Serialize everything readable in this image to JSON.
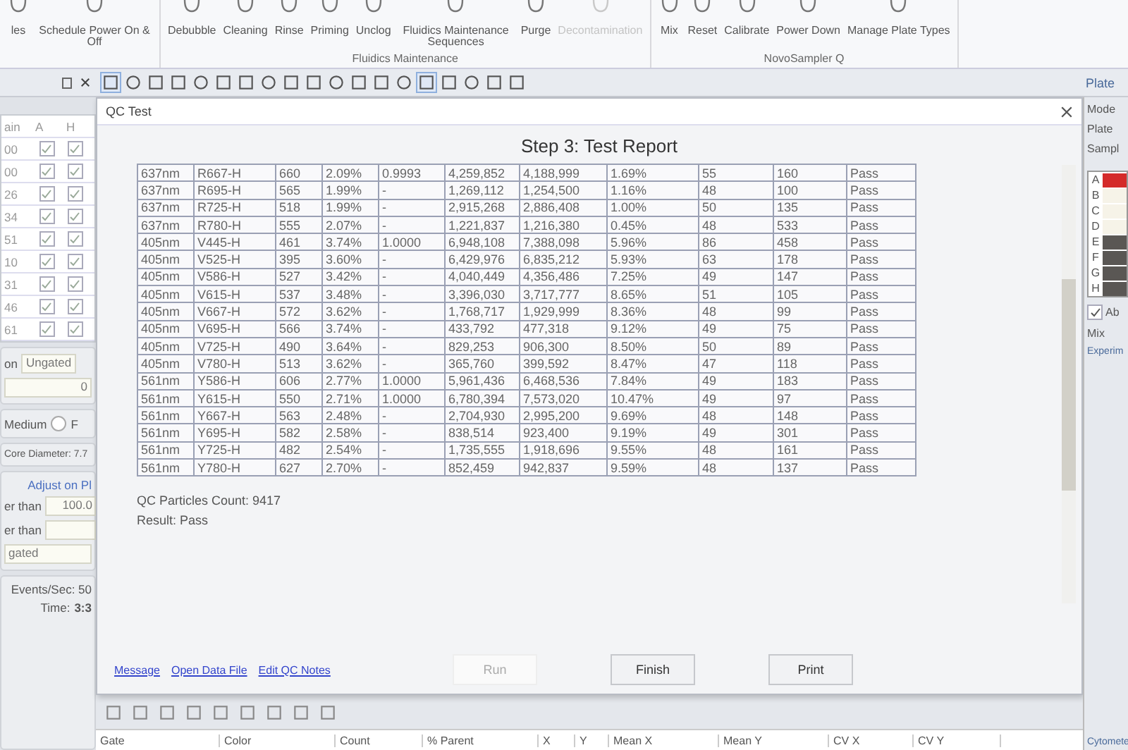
{
  "ribbon": {
    "groups": [
      {
        "items": [
          {
            "label": "les",
            "disabled": false
          },
          {
            "label": "Schedule Power On & Off",
            "disabled": false
          }
        ]
      },
      {
        "label": "Fluidics Maintenance",
        "items": [
          {
            "label": "Debubble",
            "disabled": false
          },
          {
            "label": "Cleaning",
            "disabled": false
          },
          {
            "label": "Rinse",
            "disabled": false
          },
          {
            "label": "Priming",
            "disabled": false
          },
          {
            "label": "Unclog",
            "disabled": false
          },
          {
            "label": "Fluidics Maintenance Sequences",
            "disabled": false
          },
          {
            "label": "Purge",
            "disabled": false
          },
          {
            "label": "Decontamination",
            "disabled": true
          }
        ]
      },
      {
        "label": "NovoSampler Q",
        "items": [
          {
            "label": "Mix",
            "disabled": false
          },
          {
            "label": "Reset",
            "disabled": false
          },
          {
            "label": "Calibrate",
            "disabled": false
          },
          {
            "label": "Power Down",
            "disabled": false
          },
          {
            "label": "Manage Plate Types",
            "disabled": false
          }
        ]
      }
    ]
  },
  "left_panel": {
    "columns": [
      "ain",
      "A",
      "H"
    ],
    "rows": [
      {
        "label": "00",
        "a": true,
        "h": true
      },
      {
        "label": "00",
        "a": true,
        "h": true
      },
      {
        "label": "26",
        "a": true,
        "h": true
      },
      {
        "label": "34",
        "a": true,
        "h": true
      },
      {
        "label": "51",
        "a": true,
        "h": true
      },
      {
        "label": "10",
        "a": true,
        "h": true
      },
      {
        "label": "31",
        "a": true,
        "h": true
      },
      {
        "label": "46",
        "a": true,
        "h": true
      },
      {
        "label": "61",
        "a": true,
        "h": true
      }
    ],
    "gate_label": "on",
    "gate_value": "Ungated",
    "count_value": "0",
    "speed_label": "Medium",
    "radio": {
      "label": "F",
      "selected": false
    },
    "core_diameter": "Core Diameter: 7.7",
    "adjust_link": "Adjust on Pl",
    "filter_1_label": "er than",
    "filter_1_value": "100.0",
    "filter_2_label": "er than",
    "gate_2_value": "gated",
    "events": "Events/Sec: 50",
    "time_label": "Time:",
    "time_value": "3:3"
  },
  "dialog": {
    "title": "QC Test",
    "heading": "Step 3: Test Report",
    "table": {
      "rows": [
        [
          "637nm",
          "R667-H",
          "660",
          "2.09%",
          "0.9993",
          "4,259,852",
          "4,188,999",
          "1.69%",
          "55",
          "160",
          "Pass"
        ],
        [
          "637nm",
          "R695-H",
          "565",
          "1.99%",
          "-",
          "1,269,112",
          "1,254,500",
          "1.16%",
          "48",
          "100",
          "Pass"
        ],
        [
          "637nm",
          "R725-H",
          "518",
          "1.99%",
          "-",
          "2,915,268",
          "2,886,408",
          "1.00%",
          "50",
          "135",
          "Pass"
        ],
        [
          "637nm",
          "R780-H",
          "555",
          "2.07%",
          "-",
          "1,221,837",
          "1,216,380",
          "0.45%",
          "48",
          "533",
          "Pass"
        ],
        [
          "405nm",
          "V445-H",
          "461",
          "3.74%",
          "1.0000",
          "6,948,108",
          "7,388,098",
          "5.96%",
          "86",
          "458",
          "Pass"
        ],
        [
          "405nm",
          "V525-H",
          "395",
          "3.60%",
          "-",
          "6,429,976",
          "6,835,212",
          "5.93%",
          "63",
          "178",
          "Pass"
        ],
        [
          "405nm",
          "V586-H",
          "527",
          "3.42%",
          "-",
          "4,040,449",
          "4,356,486",
          "7.25%",
          "49",
          "147",
          "Pass"
        ],
        [
          "405nm",
          "V615-H",
          "537",
          "3.48%",
          "-",
          "3,396,030",
          "3,717,777",
          "8.65%",
          "51",
          "105",
          "Pass"
        ],
        [
          "405nm",
          "V667-H",
          "572",
          "3.62%",
          "-",
          "1,768,717",
          "1,929,999",
          "8.36%",
          "48",
          "99",
          "Pass"
        ],
        [
          "405nm",
          "V695-H",
          "566",
          "3.74%",
          "-",
          "433,792",
          "477,318",
          "9.12%",
          "49",
          "75",
          "Pass"
        ],
        [
          "405nm",
          "V725-H",
          "490",
          "3.64%",
          "-",
          "829,253",
          "906,300",
          "8.50%",
          "50",
          "89",
          "Pass"
        ],
        [
          "405nm",
          "V780-H",
          "513",
          "3.62%",
          "-",
          "365,760",
          "399,592",
          "8.47%",
          "47",
          "118",
          "Pass"
        ],
        [
          "561nm",
          "Y586-H",
          "606",
          "2.77%",
          "1.0000",
          "5,961,436",
          "6,468,536",
          "7.84%",
          "49",
          "183",
          "Pass"
        ],
        [
          "561nm",
          "Y615-H",
          "550",
          "2.71%",
          "1.0000",
          "6,780,394",
          "7,573,020",
          "10.47%",
          "49",
          "97",
          "Pass"
        ],
        [
          "561nm",
          "Y667-H",
          "563",
          "2.48%",
          "-",
          "2,704,930",
          "2,995,200",
          "9.69%",
          "48",
          "148",
          "Pass"
        ],
        [
          "561nm",
          "Y695-H",
          "582",
          "2.58%",
          "-",
          "838,514",
          "923,400",
          "9.19%",
          "49",
          "301",
          "Pass"
        ],
        [
          "561nm",
          "Y725-H",
          "482",
          "2.54%",
          "-",
          "1,735,555",
          "1,918,696",
          "9.55%",
          "48",
          "161",
          "Pass"
        ],
        [
          "561nm",
          "Y780-H",
          "627",
          "2.70%",
          "-",
          "852,459",
          "942,837",
          "9.59%",
          "48",
          "137",
          "Pass"
        ]
      ]
    },
    "summary": [
      "QC Particles Count: 9417",
      "Result: Pass"
    ],
    "links": [
      "Message",
      "Open Data File",
      "Edit QC Notes"
    ],
    "buttons": [
      {
        "label": "Run",
        "disabled": true
      },
      {
        "label": "Finish",
        "disabled": false
      },
      {
        "label": "Print",
        "disabled": false
      }
    ]
  },
  "bottom_grid": {
    "columns": [
      "Gate",
      "Color",
      "Count",
      "% Parent",
      "X",
      "Y",
      "Mean X",
      "Mean Y",
      "CV X",
      "CV Y"
    ]
  },
  "right_panel": {
    "title": "Plate",
    "fields": [
      "Mode",
      "Plate",
      "Sampl"
    ],
    "wells": [
      {
        "label": "A",
        "color": "#d42a2a"
      },
      {
        "label": "B",
        "color": "#f6f3e8"
      },
      {
        "label": "C",
        "color": "#f6f3e8"
      },
      {
        "label": "D",
        "color": "#f6f3e8"
      },
      {
        "label": "E",
        "color": "#5a5754"
      },
      {
        "label": "F",
        "color": "#5a5754"
      },
      {
        "label": "G",
        "color": "#5a5754"
      },
      {
        "label": "H",
        "color": "#5a5754"
      }
    ],
    "checkbox": {
      "label": "Ab",
      "checked": true
    },
    "mix_label": "Mix",
    "section_2": "Experim",
    "section_3": "Cytomete"
  }
}
